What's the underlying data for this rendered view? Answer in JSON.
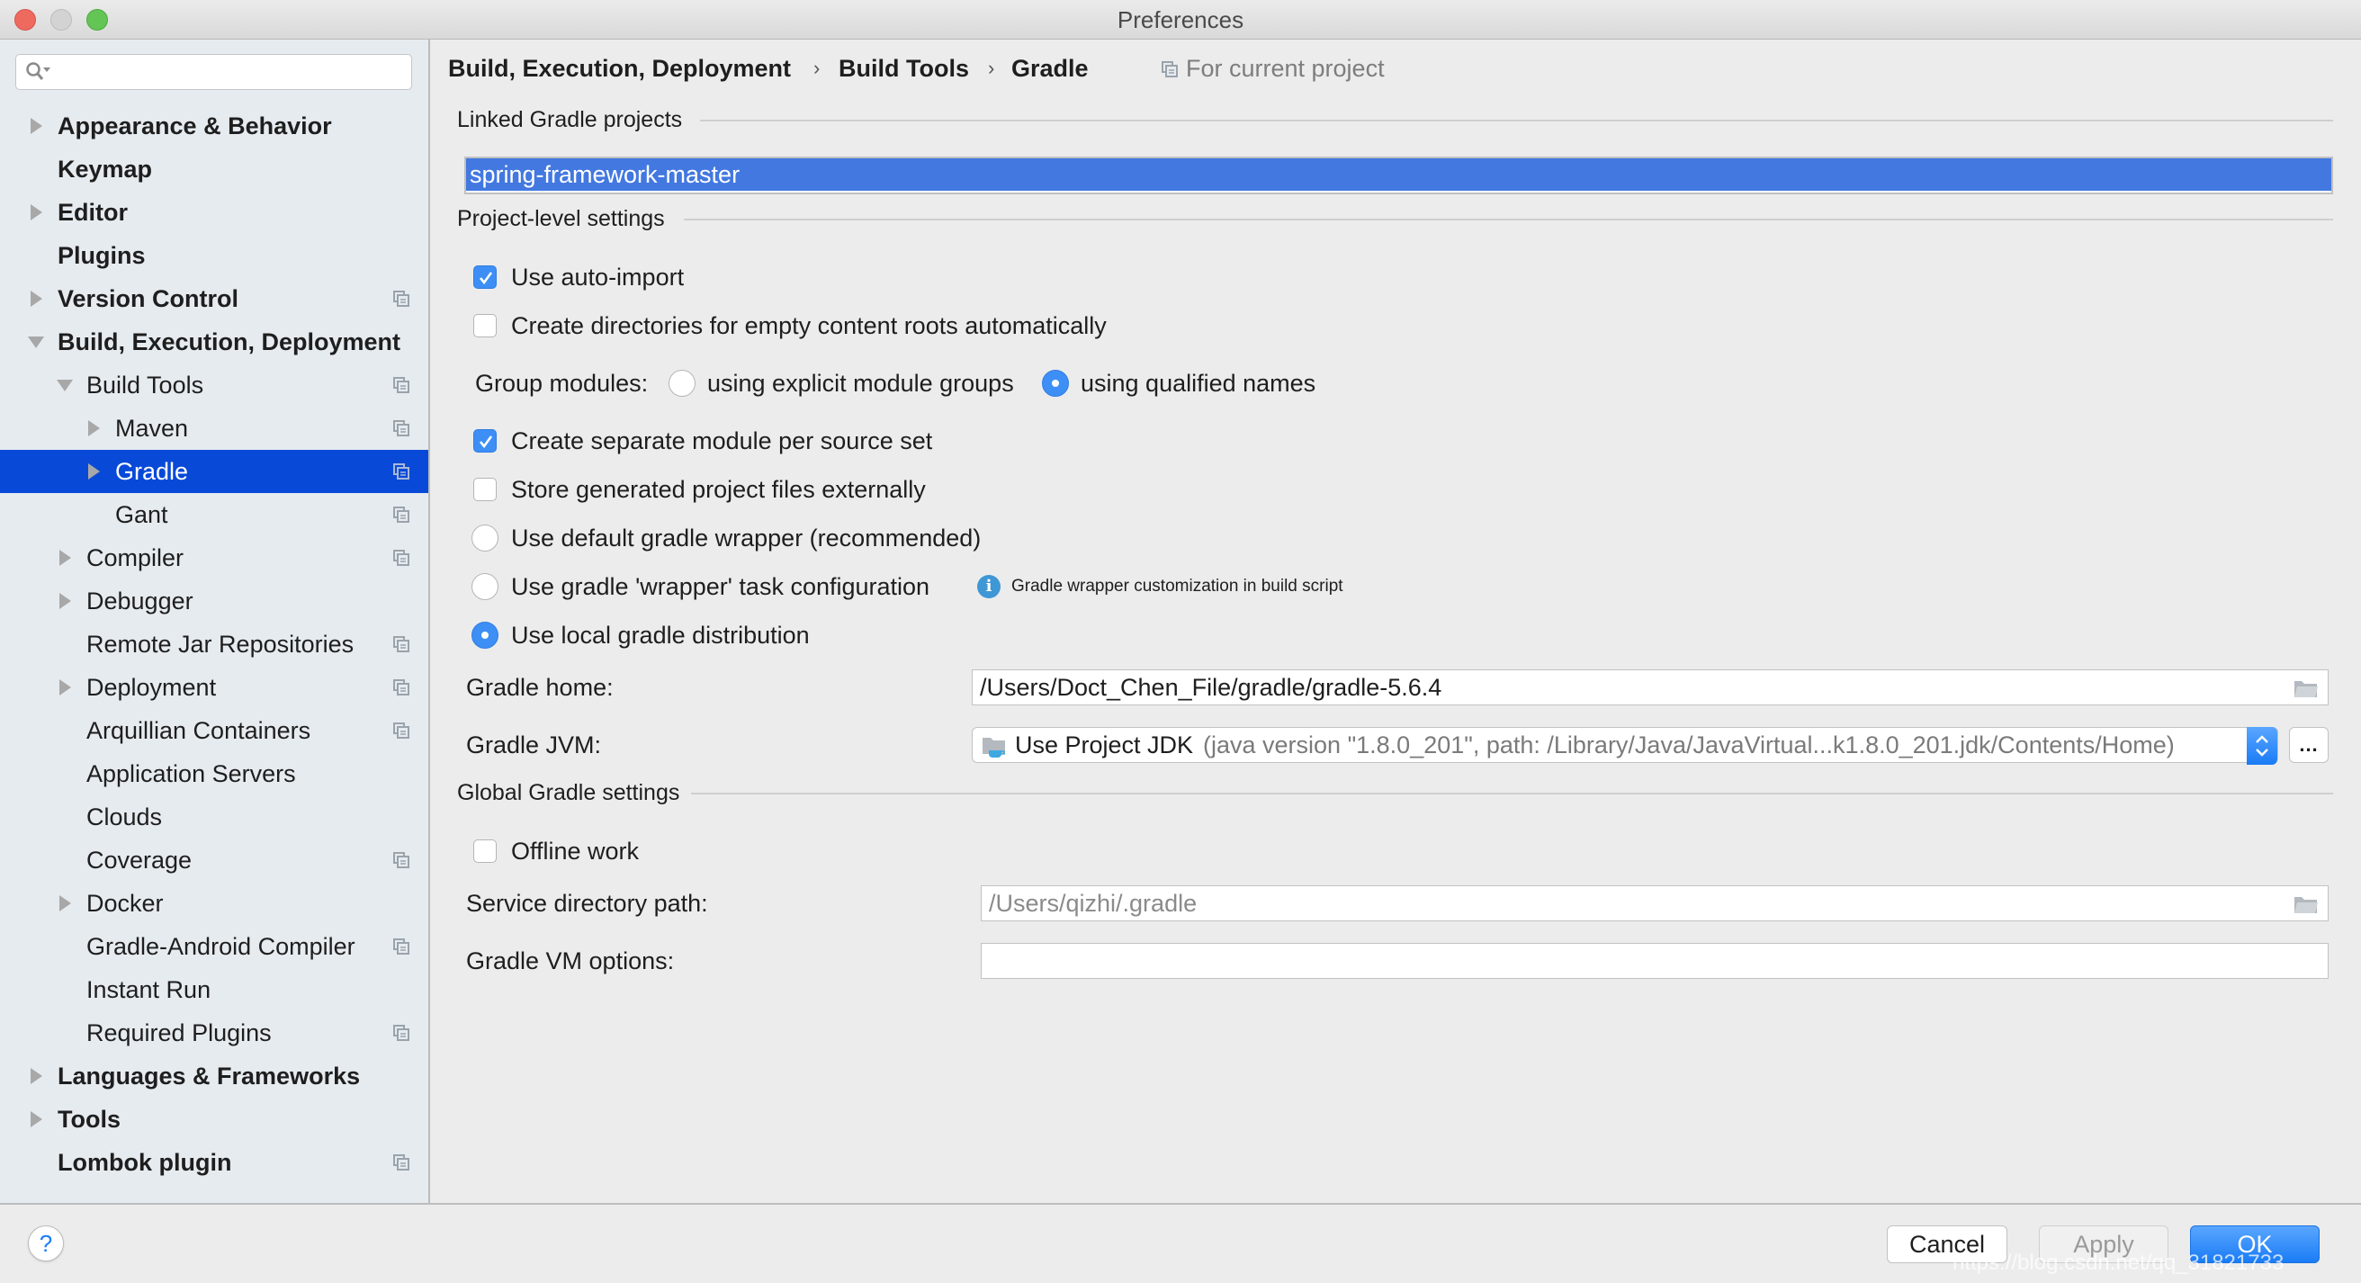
{
  "window": {
    "title": "Preferences"
  },
  "sidebar": {
    "search": {
      "placeholder": "",
      "value": ""
    },
    "items": [
      {
        "label": "Appearance & Behavior",
        "level": 0,
        "bold": true,
        "arrow": "collapsed",
        "project_icon": false,
        "selected": false
      },
      {
        "label": "Keymap",
        "level": 0,
        "bold": true,
        "arrow": "none",
        "project_icon": false,
        "selected": false
      },
      {
        "label": "Editor",
        "level": 0,
        "bold": true,
        "arrow": "collapsed",
        "project_icon": false,
        "selected": false
      },
      {
        "label": "Plugins",
        "level": 0,
        "bold": true,
        "arrow": "none",
        "project_icon": false,
        "selected": false
      },
      {
        "label": "Version Control",
        "level": 0,
        "bold": true,
        "arrow": "collapsed",
        "project_icon": true,
        "selected": false
      },
      {
        "label": "Build, Execution, Deployment",
        "level": 0,
        "bold": true,
        "arrow": "expanded",
        "project_icon": false,
        "selected": false
      },
      {
        "label": "Build Tools",
        "level": 1,
        "bold": false,
        "arrow": "expanded",
        "project_icon": true,
        "selected": false
      },
      {
        "label": "Maven",
        "level": 2,
        "bold": false,
        "arrow": "collapsed",
        "project_icon": true,
        "selected": false
      },
      {
        "label": "Gradle",
        "level": 2,
        "bold": false,
        "arrow": "collapsed",
        "project_icon": true,
        "selected": true
      },
      {
        "label": "Gant",
        "level": 2,
        "bold": false,
        "arrow": "none",
        "project_icon": true,
        "selected": false
      },
      {
        "label": "Compiler",
        "level": 1,
        "bold": false,
        "arrow": "collapsed",
        "project_icon": true,
        "selected": false
      },
      {
        "label": "Debugger",
        "level": 1,
        "bold": false,
        "arrow": "collapsed",
        "project_icon": false,
        "selected": false
      },
      {
        "label": "Remote Jar Repositories",
        "level": 1,
        "bold": false,
        "arrow": "none",
        "project_icon": true,
        "selected": false
      },
      {
        "label": "Deployment",
        "level": 1,
        "bold": false,
        "arrow": "collapsed",
        "project_icon": true,
        "selected": false
      },
      {
        "label": "Arquillian Containers",
        "level": 1,
        "bold": false,
        "arrow": "none",
        "project_icon": true,
        "selected": false
      },
      {
        "label": "Application Servers",
        "level": 1,
        "bold": false,
        "arrow": "none",
        "project_icon": false,
        "selected": false
      },
      {
        "label": "Clouds",
        "level": 1,
        "bold": false,
        "arrow": "none",
        "project_icon": false,
        "selected": false
      },
      {
        "label": "Coverage",
        "level": 1,
        "bold": false,
        "arrow": "none",
        "project_icon": true,
        "selected": false
      },
      {
        "label": "Docker",
        "level": 1,
        "bold": false,
        "arrow": "collapsed",
        "project_icon": false,
        "selected": false
      },
      {
        "label": "Gradle-Android Compiler",
        "level": 1,
        "bold": false,
        "arrow": "none",
        "project_icon": true,
        "selected": false
      },
      {
        "label": "Instant Run",
        "level": 1,
        "bold": false,
        "arrow": "none",
        "project_icon": false,
        "selected": false
      },
      {
        "label": "Required Plugins",
        "level": 1,
        "bold": false,
        "arrow": "none",
        "project_icon": true,
        "selected": false
      },
      {
        "label": "Languages & Frameworks",
        "level": 0,
        "bold": true,
        "arrow": "collapsed",
        "project_icon": false,
        "selected": false
      },
      {
        "label": "Tools",
        "level": 0,
        "bold": true,
        "arrow": "collapsed",
        "project_icon": false,
        "selected": false
      },
      {
        "label": "Lombok plugin",
        "level": 0,
        "bold": true,
        "arrow": "none",
        "project_icon": true,
        "selected": false
      }
    ]
  },
  "breadcrumb": {
    "items": [
      "Build, Execution, Deployment",
      "Build Tools",
      "Gradle"
    ],
    "separator": "›",
    "scope": "For current project"
  },
  "linked_projects": {
    "title": "Linked Gradle projects",
    "items": [
      {
        "name": "spring-framework-master",
        "selected": true
      }
    ]
  },
  "project_settings": {
    "title": "Project-level settings",
    "use_auto_import": {
      "label": "Use auto-import",
      "checked": true
    },
    "create_dirs": {
      "label": "Create directories for empty content roots automatically",
      "checked": false
    },
    "group_modules": {
      "label": "Group modules:",
      "options": [
        {
          "label": "using explicit module groups",
          "selected": false
        },
        {
          "label": "using qualified names",
          "selected": true
        }
      ]
    },
    "separate_module": {
      "label": "Create separate module per source set",
      "checked": true
    },
    "store_externally": {
      "label": "Store generated project files externally",
      "checked": false
    },
    "distribution": {
      "options": [
        {
          "label": "Use default gradle wrapper (recommended)",
          "selected": false
        },
        {
          "label": "Use gradle 'wrapper' task configuration",
          "selected": false,
          "hint": "Gradle wrapper customization in build script"
        },
        {
          "label": "Use local gradle distribution",
          "selected": true
        }
      ]
    },
    "gradle_home": {
      "label": "Gradle home:",
      "value": "/Users/Doct_Chen_File/gradle/gradle-5.6.4"
    },
    "gradle_jvm": {
      "label": "Gradle JVM:",
      "value_main": "Use Project JDK",
      "value_detail": "(java version \"1.8.0_201\", path: /Library/Java/JavaVirtual...k1.8.0_201.jdk/Contents/Home)",
      "more_label": "..."
    }
  },
  "global_settings": {
    "title": "Global Gradle settings",
    "offline_work": {
      "label": "Offline work",
      "checked": false
    },
    "service_dir": {
      "label": "Service directory path:",
      "value": "/Users/qizhi/.gradle"
    },
    "vm_options": {
      "label": "Gradle VM options:",
      "value": ""
    }
  },
  "footer": {
    "help_label": "?",
    "cancel_label": "Cancel",
    "apply_label": "Apply",
    "ok_label": "OK",
    "watermark": "https://blog.csdn.net/qq_31821733"
  },
  "colors": {
    "selection": "#0949d8",
    "list_selection": "#4278e0",
    "accent": "#3d8ff6",
    "ok_button": "#1a7cf5",
    "sidebar_bg": "#e6ebf0",
    "panel_bg": "#ececec"
  }
}
